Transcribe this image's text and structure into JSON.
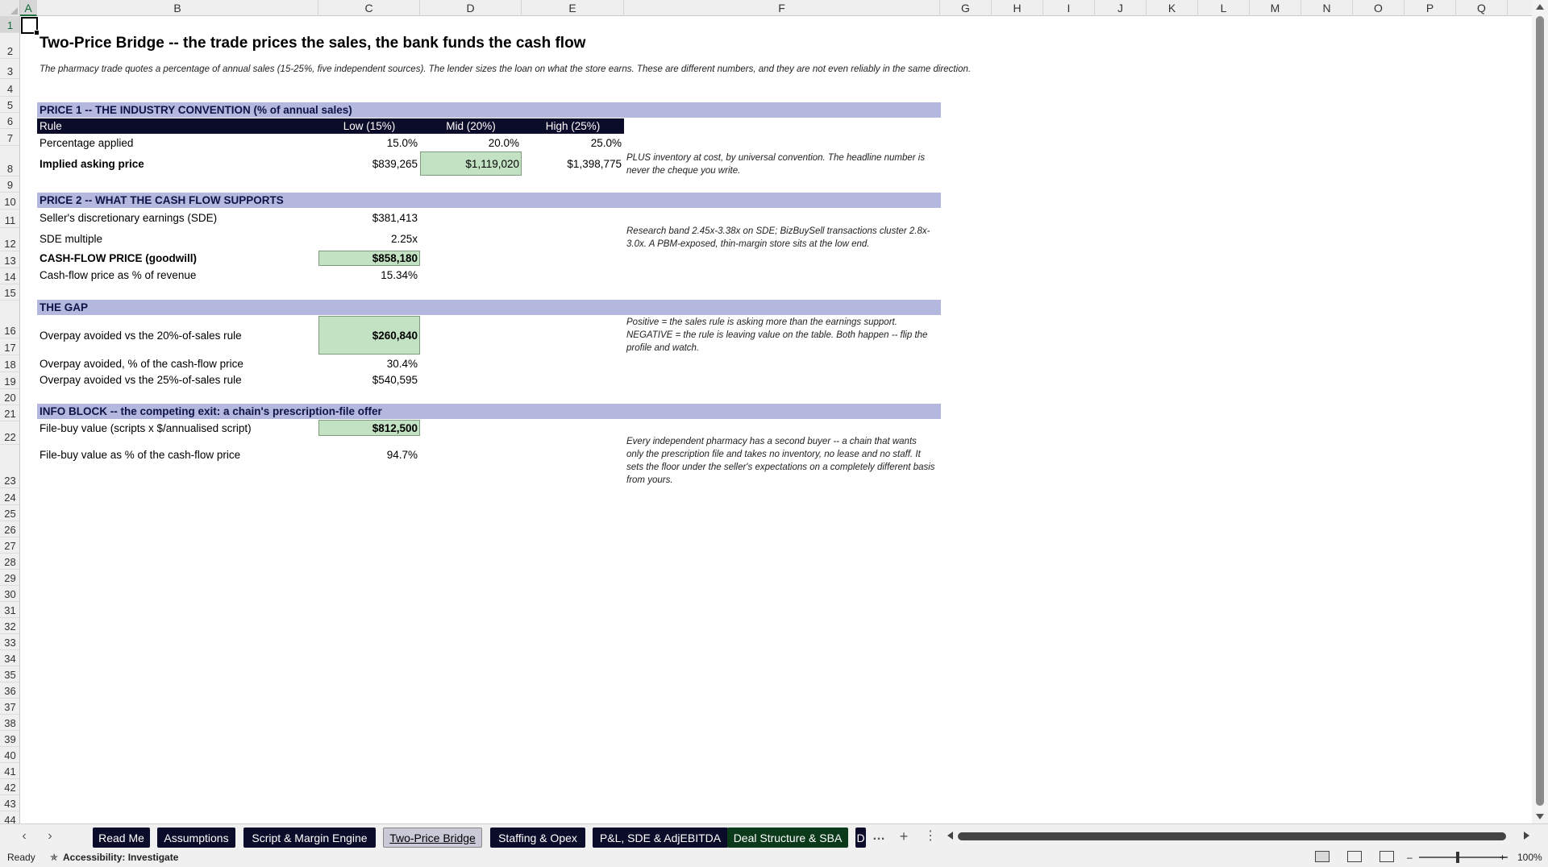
{
  "columns": [
    "A",
    "B",
    "C",
    "D",
    "E",
    "F",
    "G",
    "H",
    "I",
    "J",
    "K",
    "L",
    "M",
    "N",
    "O",
    "P",
    "Q"
  ],
  "rows": [
    "1",
    "2",
    "3",
    "4",
    "5",
    "6",
    "7",
    "8",
    "9",
    "10",
    "11",
    "12",
    "13",
    "14",
    "15",
    "16",
    "17",
    "18",
    "19",
    "20",
    "21",
    "22",
    "23",
    "24",
    "25",
    "26",
    "27",
    "28",
    "29",
    "30",
    "31",
    "32",
    "33",
    "34",
    "35",
    "36",
    "37",
    "38",
    "39",
    "40",
    "41",
    "42",
    "43",
    "44"
  ],
  "sheet": {
    "title": "Two-Price Bridge -- the trade prices the sales, the bank funds the cash flow",
    "subtitle": "The pharmacy trade quotes a percentage of annual sales (15-25%, five independent sources). The lender sizes the loan on what the store earns. These are different numbers, and they are not even reliably in the same direction.",
    "price1": {
      "header": "PRICE 1 -- THE INDUSTRY CONVENTION (% of annual sales)",
      "col_rule": "Rule",
      "col_low": "Low (15%)",
      "col_mid": "Mid (20%)",
      "col_high": "High (25%)",
      "pct_label": "Percentage applied",
      "pct_low": "15.0%",
      "pct_mid": "20.0%",
      "pct_high": "25.0%",
      "ask_label": "Implied asking price",
      "ask_low": "$839,265",
      "ask_mid": "$1,119,020",
      "ask_high": "$1,398,775",
      "note": "PLUS inventory at cost, by universal convention. The headline number is never the cheque you write."
    },
    "price2": {
      "header": "PRICE 2 -- WHAT THE CASH FLOW SUPPORTS",
      "sde_label": "Seller's discretionary earnings (SDE)",
      "sde_value": "$381,413",
      "mult_label": "SDE multiple",
      "mult_value": "2.25x",
      "cf_label": "CASH-FLOW PRICE (goodwill)",
      "cf_value": "$858,180",
      "pct_rev_label": "Cash-flow price as % of revenue",
      "pct_rev_value": "15.34%",
      "note": "Research band 2.45x-3.38x on SDE; BizBuySell transactions cluster 2.8x-3.0x. A PBM-exposed, thin-margin store sits at the low end."
    },
    "gap": {
      "header": "THE GAP",
      "over20_label": "Overpay avoided vs the 20%-of-sales rule",
      "over20_value": "$260,840",
      "overpct_label": "Overpay avoided, % of the cash-flow price",
      "overpct_value": "30.4%",
      "over25_label": "Overpay avoided vs the 25%-of-sales rule",
      "over25_value": "$540,595",
      "note": "Positive = the sales rule is asking more than the earnings support. NEGATIVE = the rule is leaving value on the table. Both happen -- flip the profile and watch."
    },
    "info": {
      "header": "INFO BLOCK -- the competing exit: a chain's prescription-file offer",
      "file_label": "File-buy value (scripts x $/annualised script)",
      "file_value": "$812,500",
      "filepct_label": "File-buy value as % of the cash-flow price",
      "filepct_value": "94.7%",
      "note": "Every independent pharmacy has a second buyer -- a chain that wants only the prescription file and takes no inventory, no lease and no staff. It sets the floor under the seller's expectations on a completely different basis from yours."
    }
  },
  "tabs": [
    "Read Me",
    "Assumptions",
    "Script & Margin Engine",
    "Two-Price Bridge",
    "Staffing & Opex",
    "P&L, SDE & AdjEBITDA",
    "Deal Structure & SBA",
    "D"
  ],
  "active_tab": "Two-Price Bridge",
  "tab_more": "…",
  "tab_add": "+",
  "tab_options": "⋮",
  "status": {
    "ready": "Ready",
    "accessibility": "Accessibility: Investigate",
    "zoom": "100%",
    "zoom_minus": "–",
    "zoom_plus": "+"
  },
  "colors": {
    "band": "#b4b7de",
    "dark": "#0b0b2a",
    "highlight": "#c3e2c3",
    "accent": "#217346"
  }
}
